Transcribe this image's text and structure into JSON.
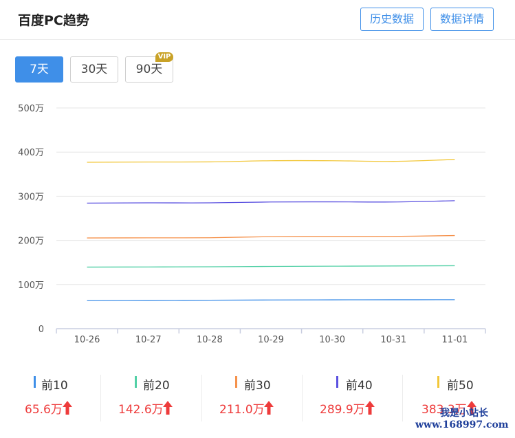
{
  "header": {
    "title": "百度PC趋势",
    "history_button": "历史数据",
    "detail_button": "数据详情"
  },
  "ranges": [
    {
      "label": "7天",
      "active": true
    },
    {
      "label": "30天",
      "active": false
    },
    {
      "label": "90天",
      "active": false
    }
  ],
  "vip_badge": "VIP",
  "chart_data": {
    "type": "line",
    "title": "",
    "xlabel": "",
    "ylabel": "",
    "categories": [
      "10-26",
      "10-27",
      "10-28",
      "10-29",
      "10-30",
      "10-31",
      "11-01"
    ],
    "ylim": [
      0,
      500
    ],
    "y_ticks": [
      "0",
      "100万",
      "200万",
      "300万",
      "400万",
      "500万"
    ],
    "y_tick_values": [
      0,
      100,
      200,
      300,
      400,
      500
    ],
    "grid": true,
    "series": [
      {
        "name": "前10",
        "color": "#3f8fe8",
        "values": [
          63.5,
          63.8,
          64.5,
          65.0,
          65.3,
          65.5,
          65.6
        ]
      },
      {
        "name": "前20",
        "color": "#52d0a6",
        "values": [
          139.5,
          139.8,
          140.2,
          141.0,
          141.5,
          142.0,
          142.6
        ]
      },
      {
        "name": "前30",
        "color": "#f5924c",
        "values": [
          205.5,
          205.8,
          206.0,
          208.5,
          208.8,
          209.0,
          211.0
        ]
      },
      {
        "name": "前40",
        "color": "#5a50e0",
        "values": [
          284.5,
          285.0,
          285.0,
          287.0,
          287.3,
          287.0,
          289.9
        ]
      },
      {
        "name": "前50",
        "color": "#f2c739",
        "values": [
          377.0,
          377.5,
          377.8,
          380.5,
          380.5,
          379.0,
          383.3
        ]
      }
    ]
  },
  "stats": [
    {
      "label": "前10",
      "value": "65.6万",
      "color": "#3f8fe8",
      "trend": "up"
    },
    {
      "label": "前20",
      "value": "142.6万",
      "color": "#52d0a6",
      "trend": "up"
    },
    {
      "label": "前30",
      "value": "211.0万",
      "color": "#f5924c",
      "trend": "up"
    },
    {
      "label": "前40",
      "value": "289.9万",
      "color": "#5a50e0",
      "trend": "up"
    },
    {
      "label": "前50",
      "value": "383.3万",
      "color": "#f2c739",
      "trend": "up"
    }
  ],
  "watermark": {
    "line1": "我是小站长",
    "line2": "www.168997.com"
  }
}
